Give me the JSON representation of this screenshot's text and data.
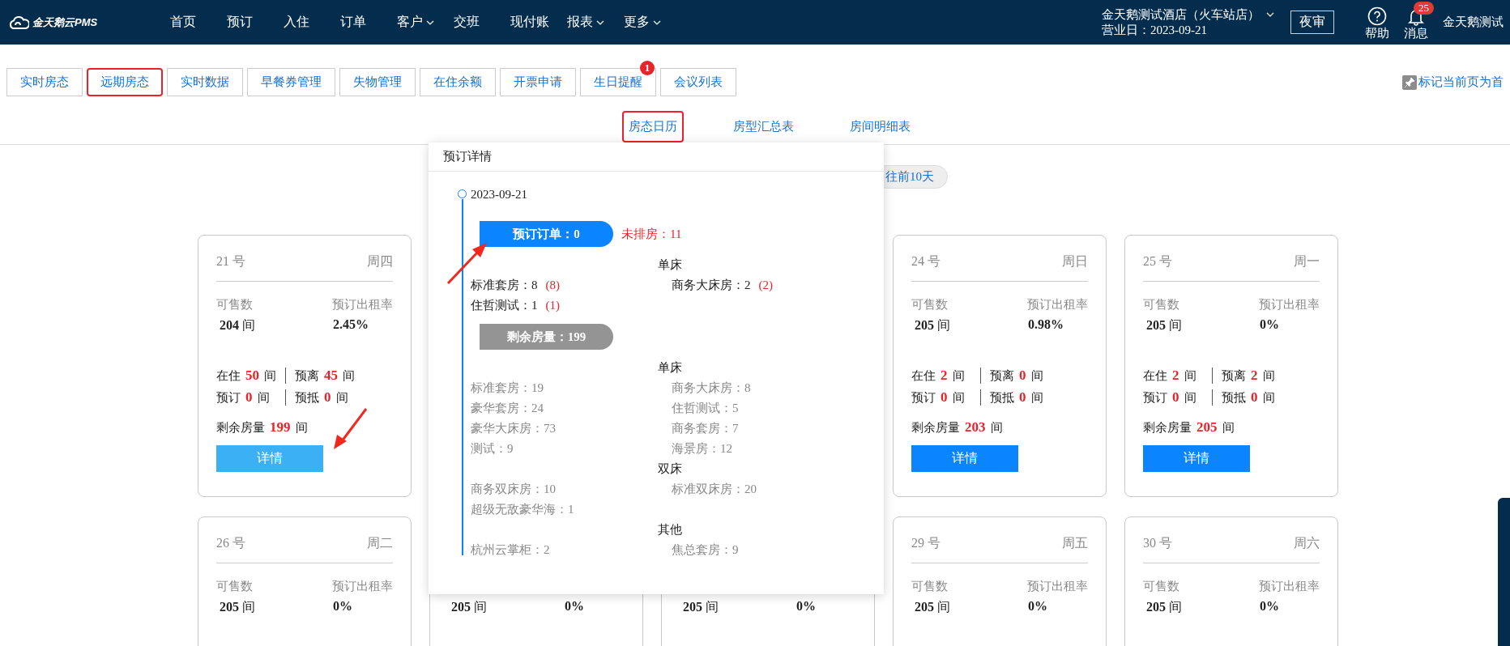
{
  "topbar": {
    "logo": "金天鹅云PMS",
    "nav": [
      {
        "label": "首页",
        "dropdown": false
      },
      {
        "label": "预订",
        "dropdown": false
      },
      {
        "label": "入住",
        "dropdown": false
      },
      {
        "label": "订单",
        "dropdown": false
      },
      {
        "label": "客户",
        "dropdown": true
      },
      {
        "label": "交班",
        "dropdown": false
      },
      {
        "label": "现付账",
        "dropdown": false
      },
      {
        "label": "报表",
        "dropdown": true
      },
      {
        "label": "更多",
        "dropdown": true
      }
    ],
    "hotel": {
      "name": "金天鹅测试酒店（火车站店）",
      "business_day": "营业日：2023-09-21"
    },
    "night_audit": "夜审",
    "help": "帮助",
    "messages": {
      "label": "消息",
      "badge": "25"
    },
    "user": "金天鹅测试"
  },
  "tabs": [
    {
      "label": "实时房态",
      "marked": false
    },
    {
      "label": "远期房态",
      "marked": true
    },
    {
      "label": "实时数据",
      "marked": false
    },
    {
      "label": "早餐券管理",
      "marked": false
    },
    {
      "label": "失物管理",
      "marked": false
    },
    {
      "label": "在住余额",
      "marked": false
    },
    {
      "label": "开票申请",
      "marked": false
    },
    {
      "label": "生日提醒",
      "marked": false,
      "badge": "1"
    },
    {
      "label": "会议列表",
      "marked": false
    }
  ],
  "pin_link": "标记当前页为首",
  "subtabs": [
    {
      "label": "房态日历",
      "marked": true
    },
    {
      "label": "房型汇总表",
      "marked": false
    },
    {
      "label": "房间明细表",
      "marked": false
    }
  ],
  "pager": "往前10天",
  "cards": [
    {
      "kind": "full",
      "day": "21 号",
      "weekday": "周四",
      "sellable_label": "可售数",
      "sellable": {
        "value": "204",
        "unit": "间"
      },
      "rate_label": "预订出租率",
      "rate": "2.45%",
      "stats": [
        {
          "label": "在住",
          "value": "50",
          "unit": "间"
        },
        {
          "label": "预离",
          "value": "45",
          "unit": "间"
        },
        {
          "label": "预订",
          "value": "0",
          "unit": "间"
        },
        {
          "label": "预抵",
          "value": "0",
          "unit": "间"
        }
      ],
      "remaining": {
        "label": "剩余房量",
        "value": "199",
        "unit": "间"
      },
      "button": {
        "label": "详情",
        "hover": true
      }
    },
    {
      "kind": "covered"
    },
    {
      "kind": "covered"
    },
    {
      "kind": "full",
      "day": "24 号",
      "weekday": "周日",
      "sellable_label": "可售数",
      "sellable": {
        "value": "205",
        "unit": "间"
      },
      "rate_label": "预订出租率",
      "rate": "0.98%",
      "stats": [
        {
          "label": "在住",
          "value": "2",
          "unit": "间"
        },
        {
          "label": "预离",
          "value": "0",
          "unit": "间"
        },
        {
          "label": "预订",
          "value": "0",
          "unit": "间"
        },
        {
          "label": "预抵",
          "value": "0",
          "unit": "间"
        }
      ],
      "remaining": {
        "label": "剩余房量",
        "value": "203",
        "unit": "间"
      },
      "button": {
        "label": "详情",
        "hover": false
      }
    },
    {
      "kind": "full",
      "day": "25 号",
      "weekday": "周一",
      "sellable_label": "可售数",
      "sellable": {
        "value": "205",
        "unit": "间"
      },
      "rate_label": "预订出租率",
      "rate": "0%",
      "stats": [
        {
          "label": "在住",
          "value": "2",
          "unit": "间"
        },
        {
          "label": "预离",
          "value": "2",
          "unit": "间"
        },
        {
          "label": "预订",
          "value": "0",
          "unit": "间"
        },
        {
          "label": "预抵",
          "value": "0",
          "unit": "间"
        }
      ],
      "remaining": {
        "label": "剩余房量",
        "value": "205",
        "unit": "间"
      },
      "button": {
        "label": "详情",
        "hover": false
      }
    },
    {
      "kind": "full",
      "day": "26 号",
      "weekday": "周二",
      "sellable_label": "可售数",
      "sellable": {
        "value": "205",
        "unit": "间"
      },
      "rate_label": "预订出租率",
      "rate": "0%"
    },
    {
      "kind": "partial",
      "sellable": {
        "value": "205",
        "unit": "间"
      },
      "rate": "0%"
    },
    {
      "kind": "partial",
      "sellable": {
        "value": "205",
        "unit": "间"
      },
      "rate": "0%"
    },
    {
      "kind": "full",
      "day": "29 号",
      "weekday": "周五",
      "sellable_label": "可售数",
      "sellable": {
        "value": "205",
        "unit": "间"
      },
      "rate_label": "预订出租率",
      "rate": "0%"
    },
    {
      "kind": "full",
      "day": "30 号",
      "weekday": "周六",
      "sellable_label": "可售数",
      "sellable": {
        "value": "205",
        "unit": "间"
      },
      "rate_label": "预订出租率",
      "rate": "0%"
    }
  ],
  "popover": {
    "title": "预订详情",
    "date": "2023-09-21",
    "booked": {
      "label": "预订订单：0",
      "unassigned": "未排房：11",
      "groups": [
        {
          "heading": "单床",
          "left": [
            {
              "text": "标准套房：8",
              "count": "(8)"
            },
            {
              "text": "住哲测试：1",
              "count": "(1)"
            }
          ],
          "right": [
            {
              "text": "商务大床房：2",
              "count": "(2)"
            }
          ]
        }
      ]
    },
    "remaining": {
      "label": "剩余房量：199",
      "groups": [
        {
          "heading": "单床",
          "left": [
            {
              "text": "标准套房：19"
            },
            {
              "text": "豪华套房：24"
            },
            {
              "text": "豪华大床房：73"
            },
            {
              "text": "测试：9"
            }
          ],
          "right": [
            {
              "text": "商务大床房：8"
            },
            {
              "text": "住哲测试：5"
            },
            {
              "text": "商务套房：7"
            },
            {
              "text": "海景房：12"
            }
          ]
        },
        {
          "heading": "双床",
          "left": [
            {
              "text": "商务双床房：10"
            },
            {
              "text": "超级无敌豪华海：1"
            }
          ],
          "right": [
            {
              "text": "标准双床房：20"
            }
          ]
        },
        {
          "heading": "其他",
          "left": [
            {
              "text": "杭州云掌柜：2"
            }
          ],
          "right": [
            {
              "text": "焦总套房：9"
            }
          ]
        }
      ]
    }
  }
}
